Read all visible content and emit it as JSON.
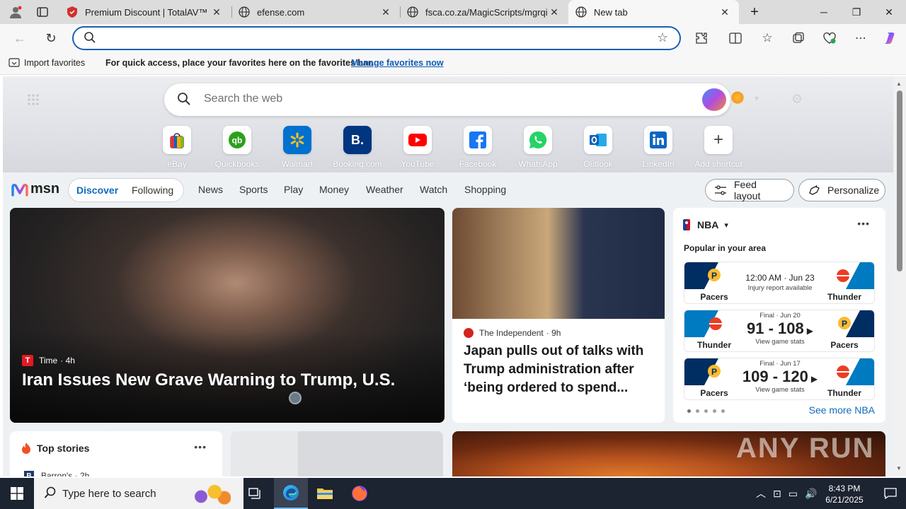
{
  "browser": {
    "tabs": [
      {
        "title": "Premium Discount | TotalAV™",
        "icon": "shield-icon"
      },
      {
        "title": "efense.com",
        "icon": "globe-icon"
      },
      {
        "title": "fsca.co.za/MagicScripts/mgrqispi.d",
        "icon": "globe-icon"
      },
      {
        "title": "New tab",
        "icon": "globe-icon"
      }
    ],
    "address_value": "",
    "favorites_bar": {
      "import_label": "Import favorites",
      "message": "For quick access, place your favorites here on the favorites bar.",
      "manage_link": "Manage favorites now"
    }
  },
  "newtab": {
    "search_placeholder": "Search the web",
    "shortcuts": [
      {
        "label": "eBay"
      },
      {
        "label": "Quickbooks"
      },
      {
        "label": "Walmart"
      },
      {
        "label": "Booking.com"
      },
      {
        "label": "YouTube"
      },
      {
        "label": "Facebook"
      },
      {
        "label": "WhatsApp"
      },
      {
        "label": "Outlook"
      },
      {
        "label": "LinkedIn"
      },
      {
        "label": "Add shortcut"
      }
    ],
    "nav": {
      "logo": "msn",
      "discover": "Discover",
      "following": "Following",
      "links": [
        "News",
        "Sports",
        "Play",
        "Money",
        "Weather",
        "Watch",
        "Shopping"
      ],
      "feed_layout": "Feed layout",
      "personalize": "Personalize"
    },
    "main_story": {
      "source": "Time",
      "age": "· 4h",
      "headline": "Iran Issues New Grave Warning to Trump, U.S."
    },
    "second_story": {
      "source": "The Independent",
      "age": "· 9h",
      "headline": "Japan pulls out of talks with Trump administration after ‘being ordered to spend..."
    },
    "nba": {
      "title": "NBA",
      "subtitle": "Popular in your area",
      "games": [
        {
          "left": "Pacers",
          "right": "Thunder",
          "line1": "12:00 AM · Jun 23",
          "line2": "Injury report available"
        },
        {
          "left": "Thunder",
          "right": "Pacers",
          "status": "Final · Jun 20",
          "score": "91 - 108",
          "cta": "View game stats"
        },
        {
          "left": "Pacers",
          "right": "Thunder",
          "status": "Final · Jun 17",
          "score": "109 - 120",
          "cta": "View game stats"
        }
      ],
      "see_more": "See more NBA"
    },
    "top_stories": {
      "title": "Top stories",
      "first_item": "Barron's · 2h"
    },
    "watermark": "ANY RUN"
  },
  "taskbar": {
    "search_placeholder": "Type here to search",
    "time": "8:43 PM",
    "date": "6/21/2025"
  },
  "colors": {
    "accent": "#1a5fb4",
    "msn_blue": "#0f6cbd",
    "taskbar": "#1c2331"
  }
}
